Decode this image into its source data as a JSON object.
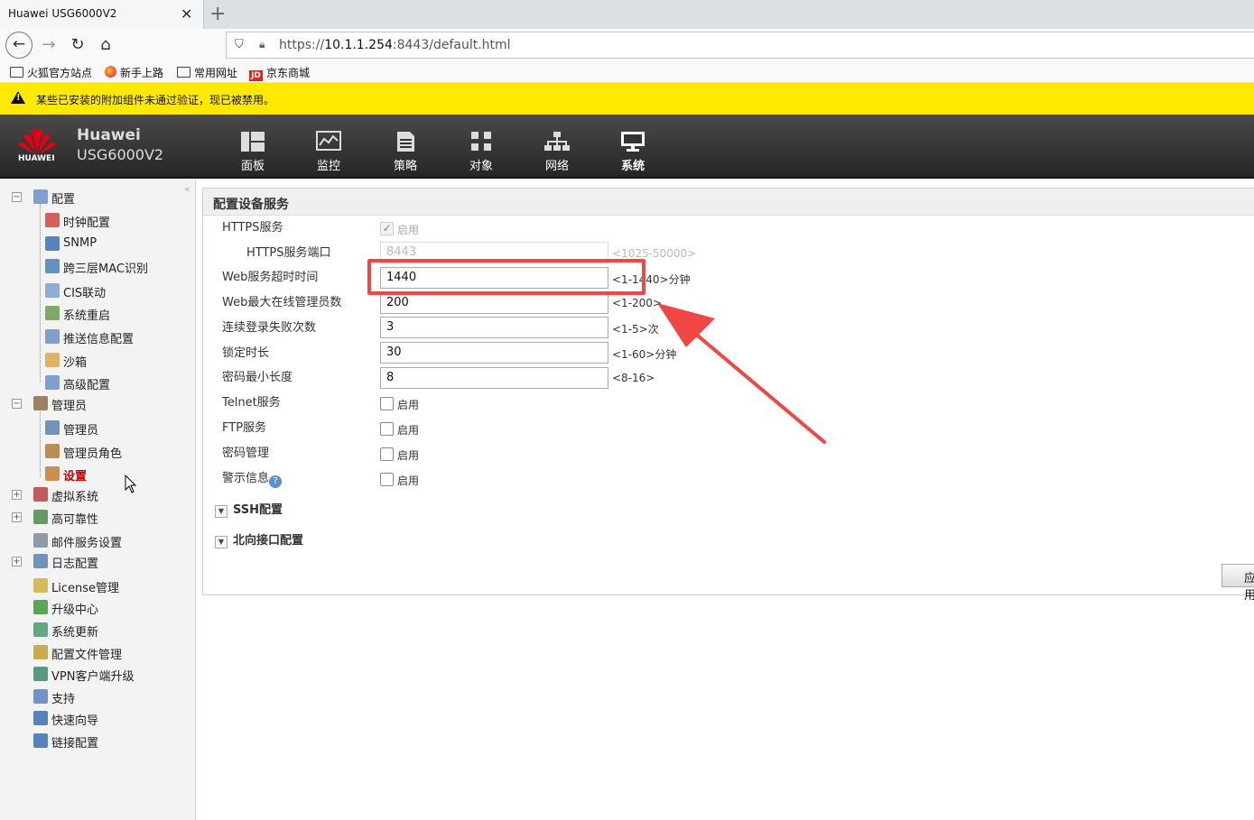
{
  "browser": {
    "tab_title": "Huawei USG6000V2",
    "tab_close": "✕",
    "new_tab": "+",
    "url_prefix": "https://",
    "url_host": "10.1.1.254",
    "url_rest": ":8443/default.html",
    "bookmarks": [
      "火狐官方站点",
      "新手上路",
      "常用网址",
      "京东商城"
    ],
    "warning": "某些已安装的附加组件未通过验证，现已被禁用。"
  },
  "app": {
    "logo_text": "HUAWEI",
    "brand_line1": "Huawei",
    "brand_line2": "USG6000V2",
    "nav": [
      "面板",
      "监控",
      "策略",
      "对象",
      "网络",
      "系统"
    ]
  },
  "sidebar": {
    "collapse": "«",
    "items": [
      {
        "label": "配置",
        "level": 0,
        "expander": "−"
      },
      {
        "label": "时钟配置",
        "level": 1
      },
      {
        "label": "SNMP",
        "level": 1
      },
      {
        "label": "跨三层MAC识别",
        "level": 1
      },
      {
        "label": "CIS联动",
        "level": 1
      },
      {
        "label": "系统重启",
        "level": 1
      },
      {
        "label": "推送信息配置",
        "level": 1
      },
      {
        "label": "沙箱",
        "level": 1
      },
      {
        "label": "高级配置",
        "level": 1
      },
      {
        "label": "管理员",
        "level": 0,
        "expander": "−"
      },
      {
        "label": "管理员",
        "level": 1
      },
      {
        "label": "管理员角色",
        "level": 1
      },
      {
        "label": "设置",
        "level": 1,
        "active": true
      },
      {
        "label": "虚拟系统",
        "level": 0,
        "expander": "+"
      },
      {
        "label": "高可靠性",
        "level": 0,
        "expander": "+"
      },
      {
        "label": "邮件服务设置",
        "level": 0
      },
      {
        "label": "日志配置",
        "level": 0,
        "expander": "+"
      },
      {
        "label": "License管理",
        "level": 0
      },
      {
        "label": "升级中心",
        "level": 0
      },
      {
        "label": "系统更新",
        "level": 0
      },
      {
        "label": "配置文件管理",
        "level": 0
      },
      {
        "label": "VPN客户端升级",
        "level": 0
      },
      {
        "label": "支持",
        "level": 0
      },
      {
        "label": "快速向导",
        "level": 0
      },
      {
        "label": "链接配置",
        "level": 0
      }
    ]
  },
  "panel": {
    "title": "配置设备服务",
    "https_service": "HTTPS服务",
    "https_enable": "启用",
    "https_port_label": "HTTPS服务端口",
    "https_port_value": "8443",
    "https_port_hint": "<1025-50000>",
    "timeout_label": "Web服务超时时间",
    "timeout_value": "1440",
    "timeout_hint": "<1-1440>分钟",
    "max_admin_label": "Web最大在线管理员数",
    "max_admin_value": "200",
    "max_admin_hint": "<1-200>",
    "login_fail_label": "连续登录失败次数",
    "login_fail_value": "3",
    "login_fail_hint": "<1-5>次",
    "lock_label": "锁定时长",
    "lock_value": "30",
    "lock_hint": "<1-60>分钟",
    "pwd_min_label": "密码最小长度",
    "pwd_min_value": "8",
    "pwd_min_hint": "<8-16>",
    "telnet_label": "Telnet服务",
    "ftp_label": "FTP服务",
    "pwd_mgmt_label": "密码管理",
    "warn_info_label": "警示信息",
    "enable": "启用",
    "ssh_section": "SSH配置",
    "north_section": "北向接口配置",
    "apply": "应用"
  },
  "colors": {
    "warning_bar": "#ffe900",
    "header_bg": "#2e2e2e",
    "annotation_red": "#f04646",
    "active_item": "#c00000"
  }
}
